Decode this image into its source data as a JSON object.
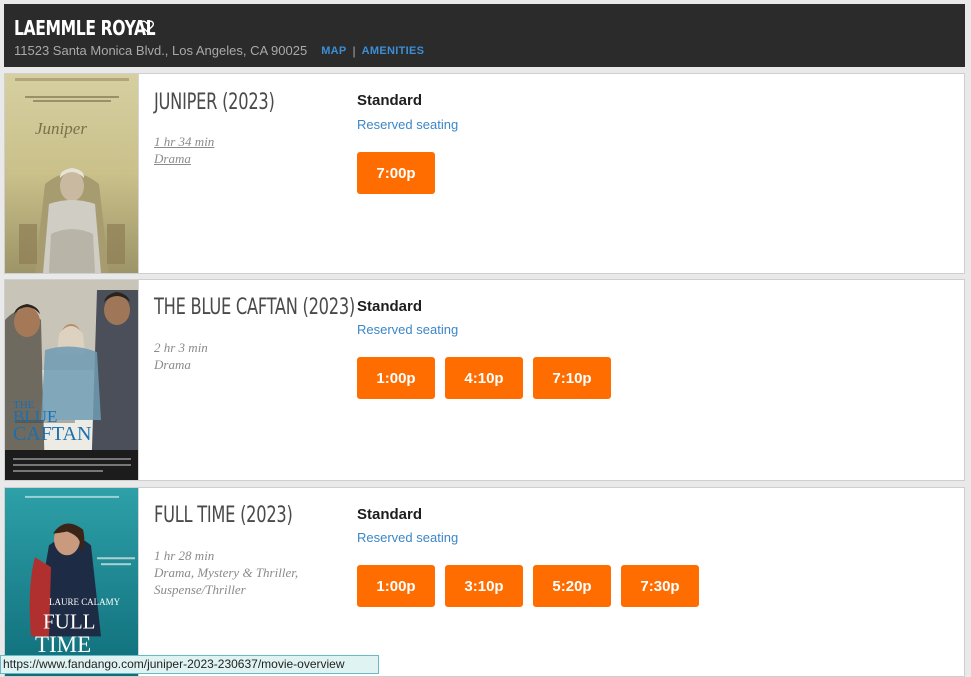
{
  "theater": {
    "name": "LAEMMLE ROYAL",
    "address": "11523 Santa Monica Blvd., Los Angeles, CA 90025",
    "map_link": "MAP",
    "separator": "|",
    "amenities_link": "AMENITIES"
  },
  "movies": [
    {
      "title": "JUNIPER (2023)",
      "runtime": "1 hr 34 min",
      "genre": "Drama",
      "format": "Standard",
      "seating": "Reserved seating",
      "showtimes": [
        "7:00p"
      ]
    },
    {
      "title": "THE BLUE CAFTAN (2023)",
      "runtime": "2 hr 3 min",
      "genre": "Drama",
      "format": "Standard",
      "seating": "Reserved seating",
      "showtimes": [
        "1:00p",
        "4:10p",
        "7:10p"
      ]
    },
    {
      "title": "FULL TIME (2023)",
      "runtime": "1 hr 28 min",
      "genre_line1": "Drama, Mystery & Thriller,",
      "genre_line2": "Suspense/Thriller",
      "format": "Standard",
      "seating": "Reserved seating",
      "showtimes": [
        "1:00p",
        "3:10p",
        "5:20p",
        "7:30p"
      ]
    }
  ],
  "posters": {
    "blue_caftan_title_line1": "THE",
    "blue_caftan_title_line2": "BLUE",
    "blue_caftan_title_line3": "CAFTAN",
    "full_time_actor": "LAURE CALAMY",
    "full_time_title_line1": "FULL",
    "full_time_title_line2": "TIME"
  },
  "status_bar": {
    "url": "https://www.fandango.com/juniper-2023-230637/movie-overview"
  },
  "colors": {
    "header_bg": "#2b2b2b",
    "accent_orange": "#ff6d00",
    "link_blue": "#3b86c9"
  }
}
